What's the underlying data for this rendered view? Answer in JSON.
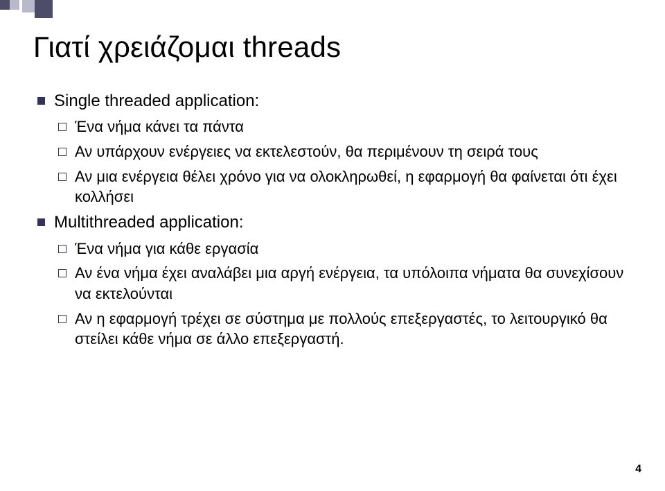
{
  "title": "Γιατί χρειάζομαι threads",
  "bullets": {
    "b1": {
      "label": "Single threaded application:",
      "items": [
        "Ένα νήμα κάνει τα πάντα",
        "Αν υπάρχουν ενέργειες να εκτελεστούν, θα περιμένουν τη σειρά τους",
        "Αν μια ενέργεια θέλει χρόνο για να ολοκληρωθεί, η εφαρμογή θα φαίνεται ότι έχει κολλήσει"
      ]
    },
    "b2": {
      "label": "Multithreaded application:",
      "items": [
        "Ένα νήμα για κάθε εργασία",
        "Αν ένα νήμα έχει αναλάβει μια αργή ενέργεια, τα υπόλοιπα νήματα θα συνεχίσουν να εκτελούνται",
        "Αν η εφαρμογή τρέχει σε σύστημα με πολλούς επεξεργαστές, το λειτουργικό θα στείλει κάθε νήμα σε άλλο επεξεργαστή."
      ]
    }
  },
  "page_number": "4"
}
